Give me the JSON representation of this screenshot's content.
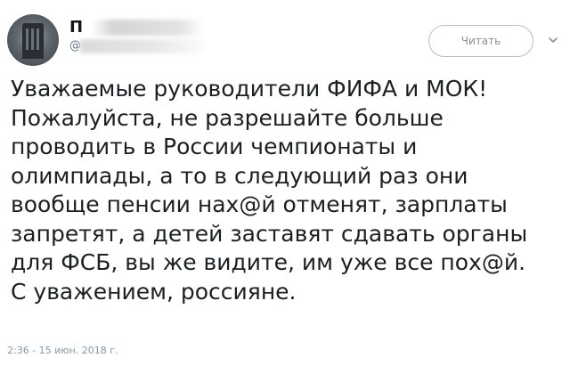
{
  "author": {
    "display_name": "П",
    "handle": "@"
  },
  "follow_button": {
    "label": "Читать"
  },
  "tweet": {
    "lines": [
      "Уважаемые руководители ФИФА и МОК!",
      "Пожалуйста, не разрешайте больше",
      "проводить в России чемпионаты и",
      "олимпиады, а то в следующий раз они",
      "вообще пенсии нах@й отменят, зарплаты",
      "запретят, а детей заставят сдавать органы",
      "для ФСБ, вы же видите, им уже все пох@й.",
      "С уважением, россияне."
    ],
    "timestamp": "2:36 - 15 июн. 2018 г."
  },
  "colors": {
    "text": "#1c1f22",
    "secondary": "#657786",
    "button_border": "#b7bdc2"
  }
}
